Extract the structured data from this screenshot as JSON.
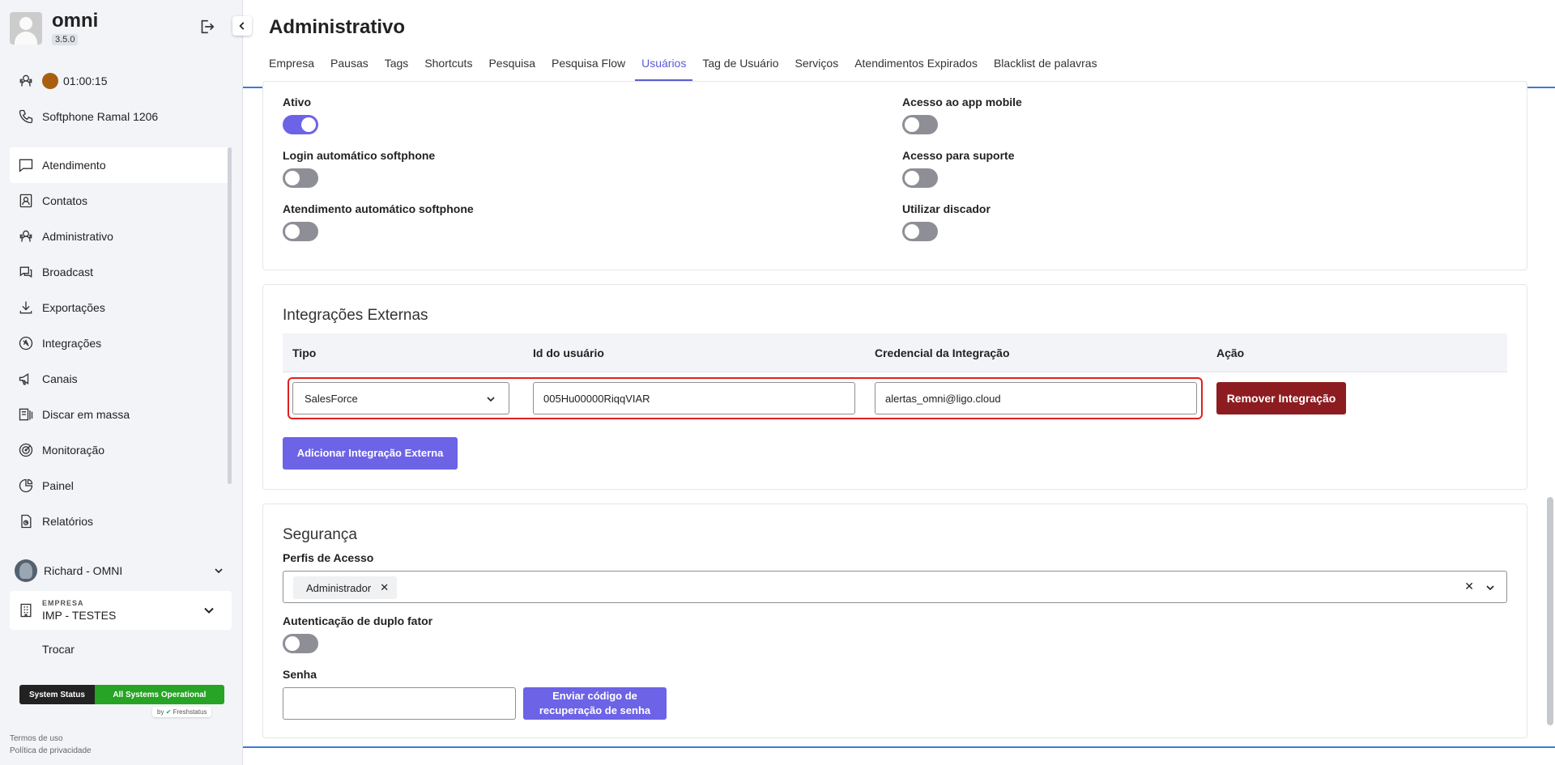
{
  "app": {
    "name": "omni",
    "version": "3.5.0"
  },
  "sidebar": {
    "timer": "01:00:15",
    "softphone": "Softphone Ramal 1206",
    "nav": [
      {
        "label": "Atendimento",
        "icon": "chat-icon",
        "active": true
      },
      {
        "label": "Contatos",
        "icon": "contacts-icon"
      },
      {
        "label": "Administrativo",
        "icon": "admin-icon"
      },
      {
        "label": "Broadcast",
        "icon": "broadcast-icon"
      },
      {
        "label": "Exportações",
        "icon": "download-icon"
      },
      {
        "label": "Integrações",
        "icon": "integrations-icon"
      },
      {
        "label": "Canais",
        "icon": "megaphone-icon"
      },
      {
        "label": "Discar em massa",
        "icon": "mass-dial-icon"
      },
      {
        "label": "Monitoração",
        "icon": "monitor-icon"
      },
      {
        "label": "Painel",
        "icon": "pie-chart-icon"
      },
      {
        "label": "Relatórios",
        "icon": "report-icon"
      }
    ],
    "user_name": "Richard - OMNI",
    "company_caption": "EMPRESA",
    "company_name": "IMP - TESTES",
    "switch_label": "Trocar",
    "status_left": "System Status",
    "status_right": "All Systems Operational",
    "status_by": "by",
    "status_brand": "Freshstatus",
    "terms": "Termos de uso",
    "privacy": "Política de privacidade"
  },
  "header": {
    "title": "Administrativo",
    "tabs": [
      "Empresa",
      "Pausas",
      "Tags",
      "Shortcuts",
      "Pesquisa",
      "Pesquisa Flow",
      "Usuários",
      "Tag de Usuário",
      "Serviços",
      "Atendimentos Expirados",
      "Blacklist de palavras"
    ],
    "active_tab": "Usuários"
  },
  "settings": {
    "ativo": {
      "label": "Ativo",
      "on": true
    },
    "login_auto": {
      "label": "Login automático softphone",
      "on": false
    },
    "atend_auto": {
      "label": "Atendimento automático softphone",
      "on": false
    },
    "app_mobile": {
      "label": "Acesso ao app mobile",
      "on": false
    },
    "suporte": {
      "label": "Acesso para suporte",
      "on": false
    },
    "discador": {
      "label": "Utilizar discador",
      "on": false
    }
  },
  "integrations": {
    "title": "Integrações Externas",
    "columns": [
      "Tipo",
      "Id do usuário",
      "Credencial da Integração",
      "Ação"
    ],
    "row": {
      "type": "SalesForce",
      "user_id": "005Hu00000RiqqVIAR",
      "credential": "alertas_omni@ligo.cloud",
      "remove_label": "Remover Integração"
    },
    "add_label": "Adicionar Integração Externa"
  },
  "security": {
    "title": "Segurança",
    "profiles_label": "Perfis de Acesso",
    "profile_chip": "Administrador",
    "twofa_label": "Autenticação de duplo fator",
    "twofa_on": false,
    "password_label": "Senha",
    "password_value": "",
    "recover_label": "Enviar código de recuperação de senha"
  },
  "colors": {
    "accent": "#6c63e6",
    "danger": "#8c1c20",
    "status_ok": "#27a325",
    "highlight": "#e02020"
  }
}
